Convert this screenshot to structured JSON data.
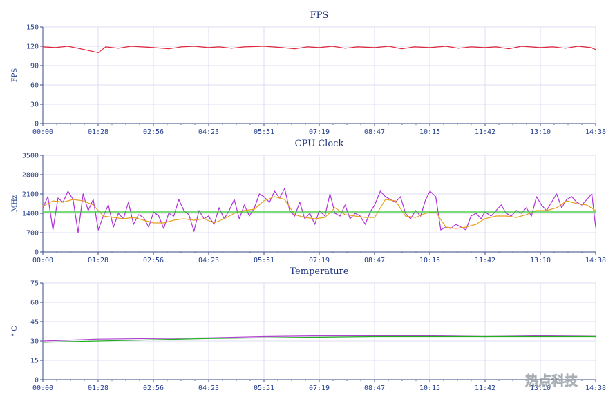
{
  "colors": {
    "grid": "#dcdcf0",
    "axis": "#3a4a8a",
    "text": "#1e3a8a",
    "fps": "#e0283c",
    "cpu_purple": "#b030d8",
    "cpu_orange": "#e8a020",
    "cpu_green": "#2ec82e",
    "temp_purple": "#b040d0",
    "temp_green": "#20b020"
  },
  "watermark": "热点科技",
  "chart_data": [
    {
      "type": "line",
      "title": "FPS",
      "ylabel": "FPS",
      "xlabel": "",
      "x_ticks": [
        "00:00",
        "01:28",
        "02:56",
        "04:23",
        "05:51",
        "07:19",
        "08:47",
        "10:15",
        "11:42",
        "13:10",
        "14:38"
      ],
      "x_range_seconds": [
        0,
        878
      ],
      "ylim": [
        0,
        150
      ],
      "y_ticks": [
        0,
        30,
        60,
        90,
        120,
        150
      ],
      "grid": true,
      "series": [
        {
          "color": "#e0283c",
          "x": [
            0,
            20,
            40,
            60,
            88,
            100,
            120,
            140,
            176,
            200,
            220,
            240,
            263,
            280,
            300,
            320,
            351,
            380,
            400,
            420,
            439,
            460,
            480,
            500,
            527,
            550,
            570,
            590,
            615,
            640,
            660,
            680,
            702,
            720,
            740,
            760,
            790,
            810,
            830,
            850,
            870,
            878
          ],
          "y": [
            119,
            118,
            120,
            116,
            110,
            119,
            117,
            120,
            118,
            116,
            119,
            120,
            118,
            119,
            117,
            119,
            120,
            118,
            116,
            119,
            118,
            120,
            117,
            119,
            118,
            120,
            116,
            119,
            118,
            120,
            117,
            119,
            118,
            119,
            116,
            120,
            118,
            119,
            117,
            120,
            118,
            115
          ]
        }
      ]
    },
    {
      "type": "line",
      "title": "CPU Clock",
      "ylabel": "MHz",
      "xlabel": "",
      "x_ticks": [
        "00:00",
        "01:28",
        "02:56",
        "04:23",
        "05:51",
        "07:19",
        "08:47",
        "10:15",
        "11:42",
        "13:10",
        "14:38"
      ],
      "x_range_seconds": [
        0,
        878
      ],
      "ylim": [
        0,
        3500
      ],
      "y_ticks": [
        0,
        700,
        1400,
        2100,
        2800,
        3500
      ],
      "grid": true,
      "series": [
        {
          "color": "#b030d8",
          "x": [
            0,
            8,
            16,
            24,
            32,
            40,
            48,
            56,
            64,
            72,
            80,
            88,
            96,
            104,
            112,
            120,
            128,
            136,
            144,
            152,
            160,
            168,
            176,
            184,
            192,
            200,
            208,
            216,
            224,
            232,
            240,
            248,
            256,
            263,
            272,
            280,
            288,
            296,
            304,
            312,
            320,
            328,
            336,
            344,
            351,
            360,
            368,
            376,
            384,
            392,
            400,
            408,
            416,
            424,
            432,
            439,
            448,
            456,
            464,
            472,
            480,
            488,
            496,
            504,
            512,
            520,
            527,
            536,
            544,
            552,
            560,
            568,
            576,
            584,
            592,
            600,
            608,
            615,
            624,
            632,
            640,
            648,
            656,
            664,
            672,
            680,
            688,
            696,
            702,
            712,
            720,
            728,
            736,
            744,
            752,
            760,
            768,
            776,
            784,
            792,
            800,
            808,
            816,
            824,
            832,
            840,
            848,
            856,
            864,
            872,
            878
          ],
          "y": [
            1600,
            2000,
            800,
            1950,
            1800,
            2200,
            1900,
            700,
            2100,
            1500,
            1900,
            800,
            1300,
            1700,
            900,
            1400,
            1200,
            1800,
            1000,
            1350,
            1250,
            900,
            1450,
            1300,
            850,
            1400,
            1300,
            1900,
            1500,
            1350,
            750,
            1500,
            1200,
            1300,
            1000,
            1600,
            1200,
            1500,
            1900,
            1200,
            1700,
            1300,
            1600,
            2100,
            2000,
            1800,
            2200,
            1950,
            2300,
            1500,
            1300,
            1800,
            1200,
            1400,
            1000,
            1500,
            1300,
            2100,
            1400,
            1300,
            1700,
            1200,
            1400,
            1300,
            1000,
            1450,
            1700,
            2200,
            2000,
            1900,
            1800,
            2000,
            1400,
            1200,
            1500,
            1300,
            1900,
            2200,
            2000,
            800,
            900,
            850,
            1000,
            900,
            800,
            1300,
            1400,
            1200,
            1450,
            1300,
            1500,
            1700,
            1400,
            1300,
            1500,
            1400,
            1600,
            1300,
            2000,
            1700,
            1500,
            1800,
            2100,
            1600,
            1900,
            2000,
            1800,
            1700,
            1900,
            2100,
            900
          ]
        },
        {
          "color": "#e8a020",
          "x": [
            0,
            16,
            32,
            48,
            64,
            80,
            96,
            112,
            128,
            144,
            160,
            176,
            192,
            208,
            224,
            240,
            256,
            272,
            288,
            304,
            320,
            336,
            351,
            368,
            384,
            400,
            416,
            432,
            448,
            464,
            480,
            496,
            512,
            527,
            544,
            560,
            576,
            592,
            608,
            624,
            640,
            656,
            672,
            688,
            702,
            720,
            736,
            752,
            768,
            784,
            800,
            816,
            832,
            848,
            864,
            878
          ],
          "y": [
            1650,
            1850,
            1800,
            1900,
            1850,
            1700,
            1300,
            1250,
            1200,
            1250,
            1150,
            1050,
            1050,
            1150,
            1200,
            1150,
            1200,
            1050,
            1200,
            1400,
            1500,
            1550,
            1850,
            2000,
            1900,
            1350,
            1250,
            1200,
            1250,
            1600,
            1350,
            1300,
            1250,
            1250,
            1900,
            1850,
            1300,
            1250,
            1400,
            1450,
            900,
            850,
            900,
            1000,
            1200,
            1300,
            1300,
            1250,
            1350,
            1500,
            1500,
            1600,
            1850,
            1750,
            1700,
            1500
          ]
        },
        {
          "color": "#2ec82e",
          "x": [
            0,
            878
          ],
          "y": [
            1450,
            1450
          ]
        }
      ]
    },
    {
      "type": "line",
      "title": "Temperature",
      "ylabel": "° C",
      "xlabel": "",
      "x_ticks": [
        "00:00",
        "01:28",
        "02:56",
        "04:23",
        "05:51",
        "07:19",
        "08:47",
        "10:15",
        "11:42",
        "13:10",
        "14:38"
      ],
      "x_range_seconds": [
        0,
        878
      ],
      "ylim": [
        0,
        75
      ],
      "y_ticks": [
        0,
        15,
        30,
        45,
        60,
        75
      ],
      "grid": true,
      "series": [
        {
          "color": "#b040d0",
          "x": [
            0,
            88,
            176,
            263,
            351,
            439,
            527,
            615,
            702,
            790,
            878
          ],
          "y": [
            30,
            31.5,
            32,
            32.5,
            33.5,
            34,
            34,
            34,
            33.5,
            34,
            34.5
          ]
        },
        {
          "color": "#20b020",
          "x": [
            0,
            88,
            176,
            263,
            351,
            439,
            527,
            615,
            702,
            790,
            878
          ],
          "y": [
            29,
            30,
            31,
            32,
            32.5,
            33,
            33.5,
            33.5,
            33.5,
            33.5,
            33.5
          ]
        }
      ]
    }
  ]
}
